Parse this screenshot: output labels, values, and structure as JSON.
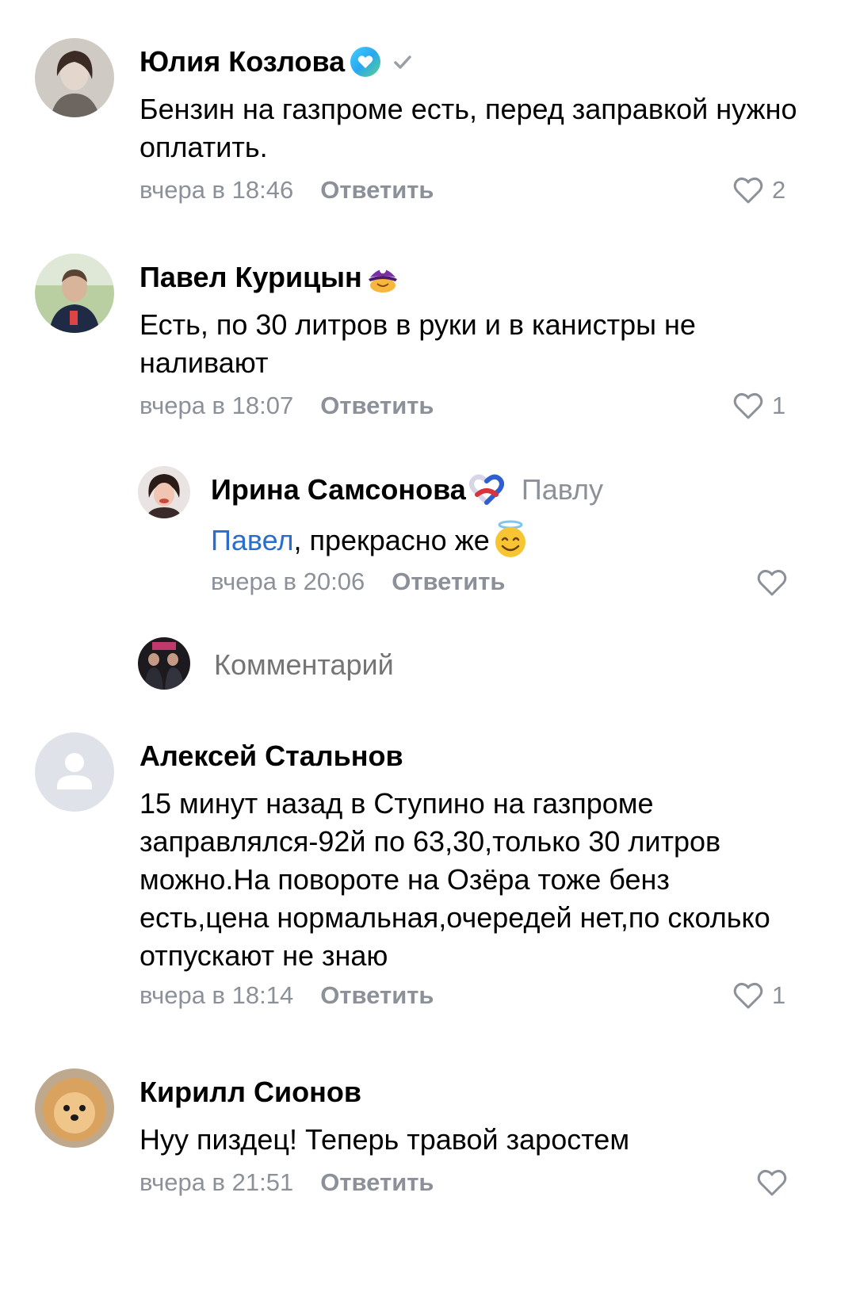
{
  "comments": [
    {
      "author": "Юлия Козлова",
      "text": "Бензин на газпроме есть, перед заправкой нужно оплатить.",
      "time": "вчера в 18:46",
      "reply_label": "Ответить",
      "likes": "2",
      "badge_icon": "heart-circle-badge-icon",
      "verified_icon": "checkmark-icon"
    },
    {
      "author": "Павел Курицын",
      "text": "Есть, по 30 литров в руки и в канистры не наливают",
      "time": "вчера в 18:07",
      "reply_label": "Ответить",
      "likes": "1",
      "badge_icon": "pirate-badge-icon"
    },
    {
      "author": "Ирина Самсонова",
      "reply_to": "Павлу",
      "mention": "Павел",
      "text_rest": ", прекрасно же",
      "emoji": "smiling-face-with-halo",
      "time": "вчера в 20:06",
      "reply_label": "Ответить",
      "badge_icon": "tricolor-heart-badge-icon"
    },
    {
      "author": "Алексей Стальнов",
      "text": "15 минут назад в Ступино на газпроме заправлялся-92й по 63,30,только 30 литров можно.На повороте на Озёра тоже бенз есть,цена нормальная,очередей нет,по сколько отпускают не знаю",
      "time": "вчера в 18:14",
      "reply_label": "Ответить",
      "likes": "1"
    },
    {
      "author": "Кирилл Сионов",
      "text": "Нуу пиздец! Теперь травой заростем",
      "time": "вчера в 21:51",
      "reply_label": "Ответить"
    }
  ],
  "compose": {
    "placeholder": "Комментарий"
  },
  "colors": {
    "secondary_text": "#8c9199",
    "mention": "#2a6dcc",
    "text": "#000000"
  }
}
